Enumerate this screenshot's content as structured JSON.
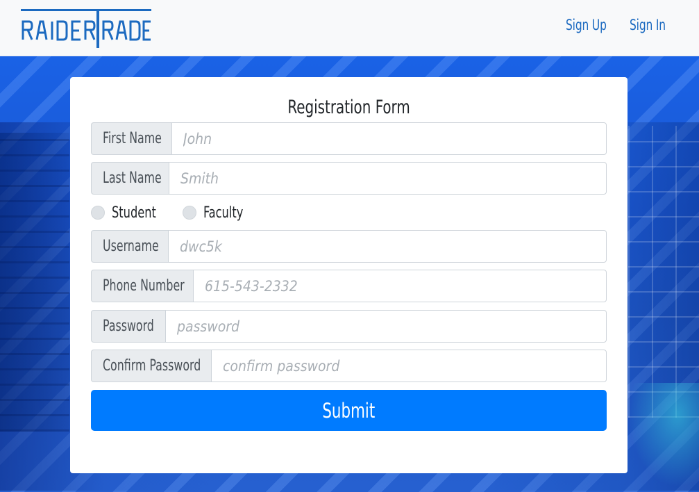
{
  "header": {
    "logo_text": "RAIDER TRADE",
    "nav": [
      {
        "label": "Sign Up"
      },
      {
        "label": "Sign In"
      }
    ]
  },
  "form": {
    "title": "Registration Form",
    "first_name": {
      "label": "First Name",
      "placeholder": "John",
      "value": ""
    },
    "last_name": {
      "label": "Last Name",
      "placeholder": "Smith",
      "value": ""
    },
    "role_options": [
      {
        "label": "Student",
        "checked": false
      },
      {
        "label": "Faculty",
        "checked": false
      }
    ],
    "username": {
      "label": "Username",
      "placeholder": "dwc5k",
      "value": ""
    },
    "phone": {
      "label": "Phone Number",
      "placeholder": "615-543-2332",
      "value": ""
    },
    "password": {
      "label": "Password",
      "placeholder": "password",
      "value": ""
    },
    "confirm_password": {
      "label": "Confirm Password",
      "placeholder": "confirm password",
      "value": ""
    },
    "submit_label": "Submit"
  },
  "colors": {
    "brand": "#1c6ac0",
    "primary_button": "#007bff",
    "background": "#1b57d2"
  },
  "icons": [
    "logo-icon"
  ]
}
